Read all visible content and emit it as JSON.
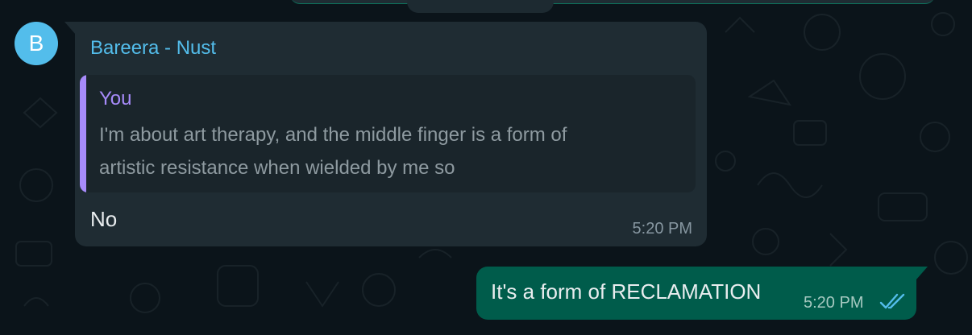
{
  "incoming": {
    "avatar_initial": "B",
    "sender": "Bareera - Nust",
    "quote": {
      "author": "You",
      "text": "I'm about art therapy, and the middle finger is a form of artistic resistance when wielded by me so"
    },
    "text": "No",
    "time": "5:20 PM"
  },
  "outgoing": {
    "text": "It's a form of RECLAMATION",
    "time": "5:20 PM",
    "status_icon": "double-check-icon"
  },
  "colors": {
    "background": "#0b141a",
    "incoming_bubble": "#1f2c33",
    "outgoing_bubble": "#005c4b",
    "sender_name": "#53bdeb",
    "quote_accent": "#a78bfa",
    "read_ticks": "#53bdeb"
  }
}
